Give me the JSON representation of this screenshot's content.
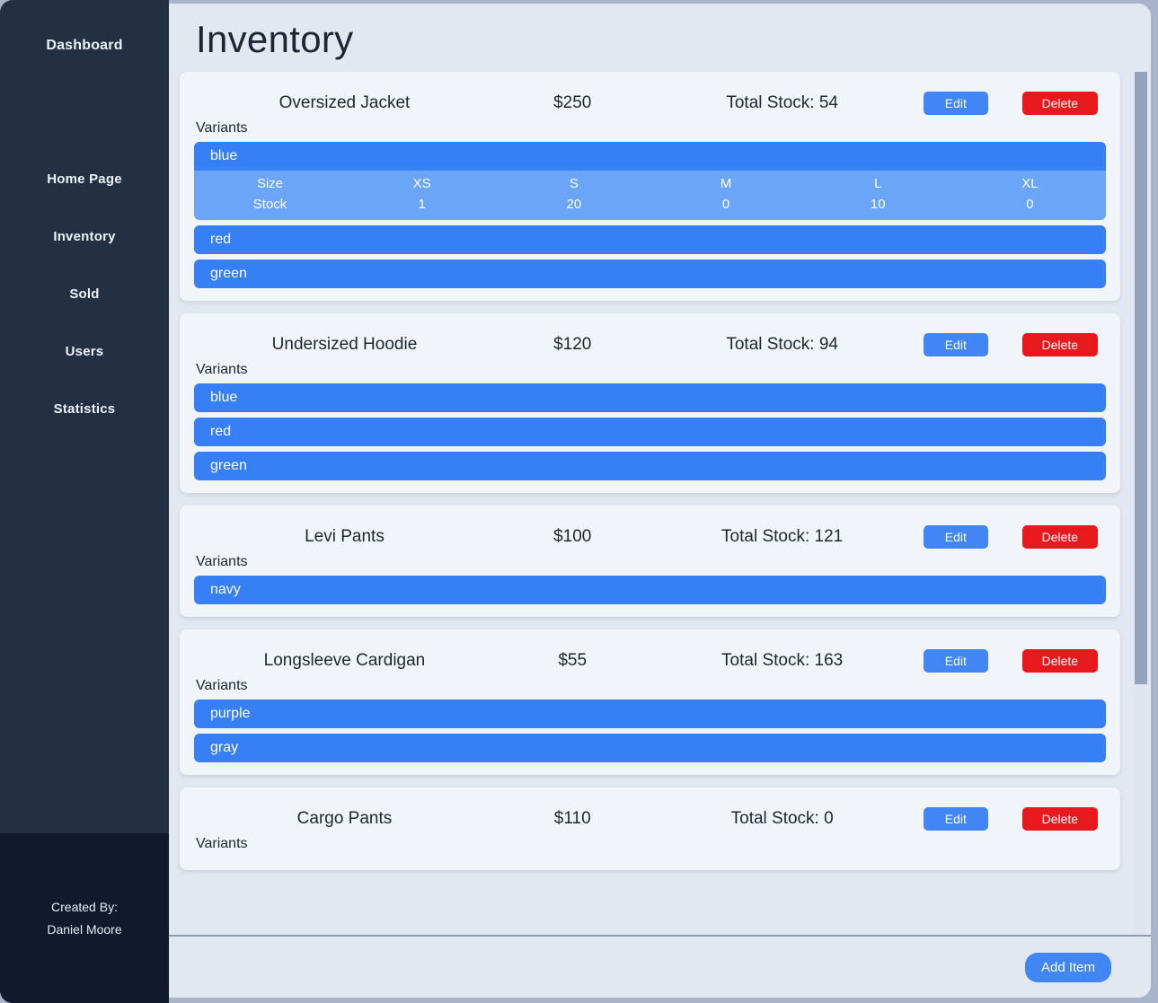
{
  "sidebar": {
    "brand": "Dashboard",
    "items": [
      {
        "label": "Home Page"
      },
      {
        "label": "Inventory"
      },
      {
        "label": "Sold"
      },
      {
        "label": "Users"
      },
      {
        "label": "Statistics"
      }
    ],
    "footer": {
      "line1": "Created By:",
      "line2": "Daniel Moore"
    }
  },
  "header": {
    "title": "Inventory"
  },
  "labels": {
    "variants": "Variants",
    "size": "Size",
    "stock": "Stock",
    "edit": "Edit",
    "delete": "Delete",
    "add_item": "Add Item"
  },
  "colors": {
    "sidebar_bg": "#232f43",
    "sidebar_footer_bg": "#101a2c",
    "page_bg": "#a7b4c9",
    "main_bg": "#e2e8f0",
    "card_bg": "#f1f4f8",
    "variant_bar": "#377ff5",
    "variant_table": "#6ba5f7",
    "edit": "#4285f4",
    "delete": "#e8191c",
    "scrollbar_thumb": "#93a2bd"
  },
  "products": [
    {
      "name": "Oversized Jacket",
      "price": "$250",
      "total_stock": "Total Stock: 54",
      "variants": [
        {
          "color": "blue",
          "expanded": true,
          "sizes": [
            "XS",
            "S",
            "M",
            "L",
            "XL"
          ],
          "stocks": [
            "1",
            "20",
            "0",
            "10",
            "0"
          ]
        },
        {
          "color": "red",
          "expanded": false
        },
        {
          "color": "green",
          "expanded": false
        }
      ]
    },
    {
      "name": "Undersized Hoodie",
      "price": "$120",
      "total_stock": "Total Stock: 94",
      "variants": [
        {
          "color": "blue",
          "expanded": false
        },
        {
          "color": "red",
          "expanded": false
        },
        {
          "color": "green",
          "expanded": false
        }
      ]
    },
    {
      "name": "Levi Pants",
      "price": "$100",
      "total_stock": "Total Stock: 121",
      "variants": [
        {
          "color": "navy",
          "expanded": false
        }
      ]
    },
    {
      "name": "Longsleeve Cardigan",
      "price": "$55",
      "total_stock": "Total Stock: 163",
      "variants": [
        {
          "color": "purple",
          "expanded": false
        },
        {
          "color": "gray",
          "expanded": false
        }
      ]
    },
    {
      "name": "Cargo Pants",
      "price": "$110",
      "total_stock": "Total Stock: 0",
      "variants": []
    }
  ]
}
